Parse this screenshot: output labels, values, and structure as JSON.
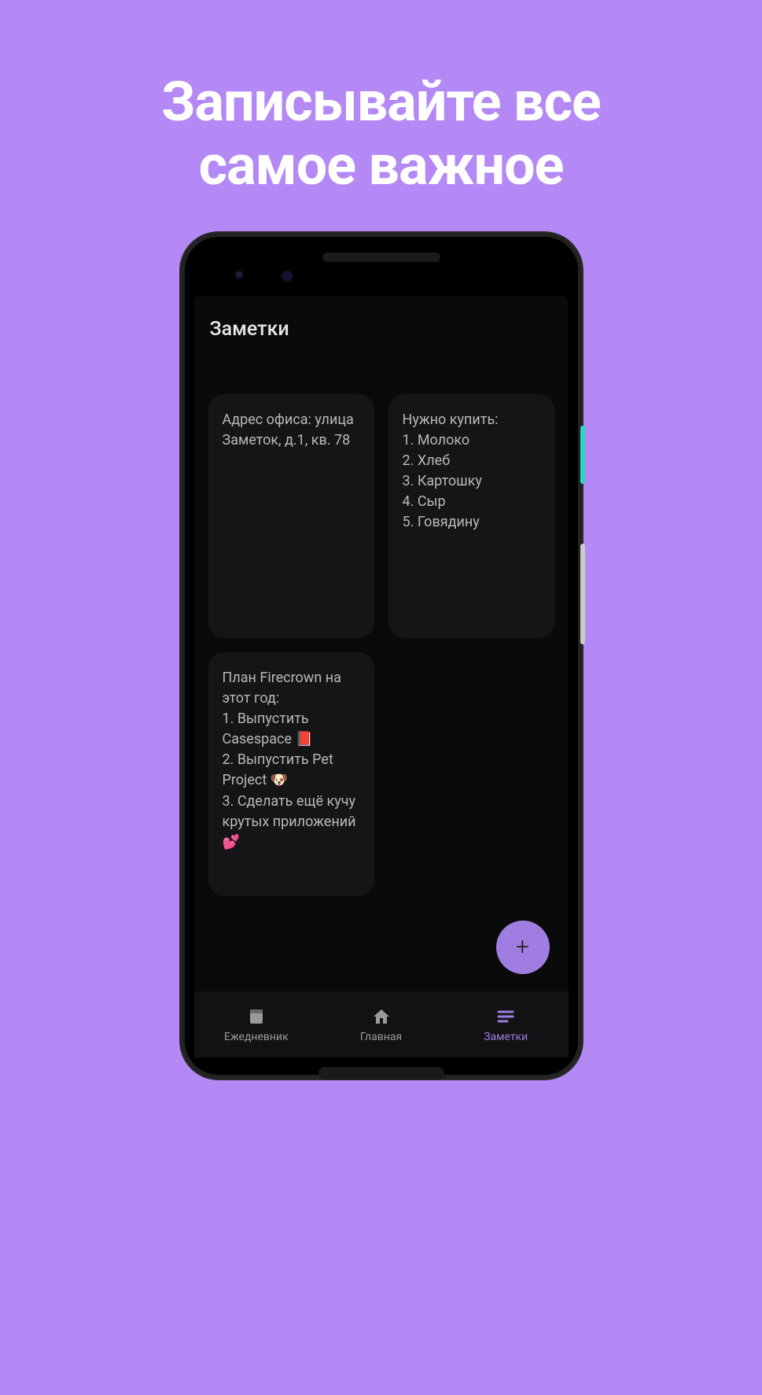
{
  "hero": {
    "line1": "Записывайте все",
    "line2": "самое важное"
  },
  "screen": {
    "title": "Заметки"
  },
  "notes": [
    {
      "text": "Адрес офиса: улица Заметок, д.1, кв. 78"
    },
    {
      "text": "Нужно купить:\n1. Молоко\n2. Хлеб\n3. Картошку\n4. Сыр\n5. Говядину"
    },
    {
      "text": "План Firecrown на этот год:\n1. Выпустить Casespace 📕\n2. Выпустить Pet Project 🐶\n3. Сделать ещё кучу крутых приложений 💕"
    }
  ],
  "fab": {
    "icon": "+"
  },
  "nav": {
    "items": [
      {
        "label": "Ежедневник",
        "icon": "book-icon",
        "active": false
      },
      {
        "label": "Главная",
        "icon": "home-icon",
        "active": false
      },
      {
        "label": "Заметки",
        "icon": "list-icon",
        "active": true
      }
    ]
  },
  "colors": {
    "accent": "#a07de0",
    "bg": "#b489f5"
  }
}
